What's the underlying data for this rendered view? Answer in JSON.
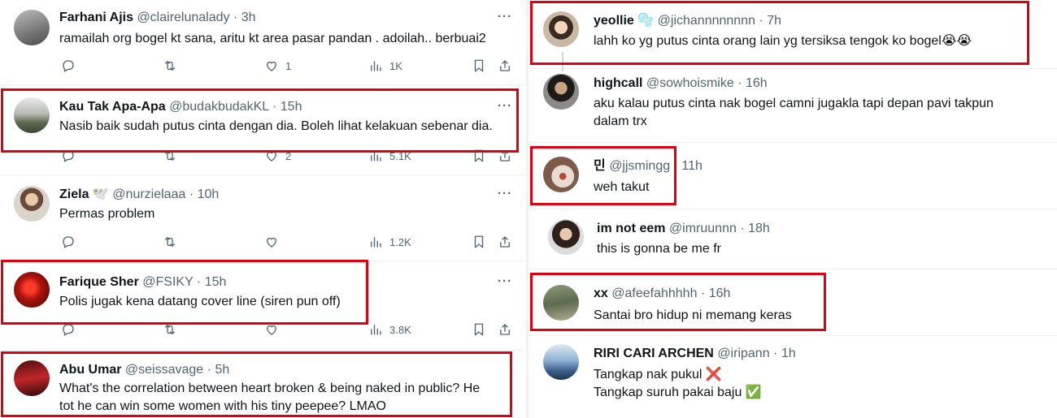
{
  "left": [
    {
      "name": "Farhani Ajis",
      "handle": "@clairelunalady",
      "time": "3h",
      "text": [
        "ramailah org bogel kt sana, aritu kt area pasar pandan . adoilah.. berbuai2"
      ],
      "likes": "1",
      "views": "1K"
    },
    {
      "name": "Kau Tak Apa-Apa",
      "handle": "@budakbudakKL",
      "time": "15h",
      "text": [
        "Nasib baik sudah putus cinta dengan dia. Boleh lihat kelakuan sebenar dia."
      ],
      "likes": "2",
      "views": "5.1K"
    },
    {
      "name": "Ziela",
      "name_emoji": "🕊️",
      "handle": "@nurzielaaa",
      "time": "10h",
      "text": [
        "Permas problem"
      ],
      "likes": "",
      "views": "1.2K"
    },
    {
      "name": "Farique Sher",
      "handle": "@FSIKY",
      "time": "15h",
      "text": [
        "Polis jugak kena datang cover line (siren pun off)"
      ],
      "likes": "",
      "views": "3.8K"
    },
    {
      "name": "Abu Umar",
      "handle": "@seissavage",
      "time": "5h",
      "text": [
        "What's the correlation between heart broken & being naked in public? He",
        "tot he can win some women with his tiny peepee? LMAO"
      ]
    }
  ],
  "right": [
    {
      "name": "yeollie",
      "name_emoji": "🫧",
      "handle": "@jichannnnnnnn",
      "time": "7h",
      "text": [
        "lahh ko yg putus cinta orang lain yg tersiksa tengok ko bogel😭😭"
      ]
    },
    {
      "name": "highcall",
      "handle": "@sowhoismike",
      "time": "16h",
      "text": [
        "aku kalau putus cinta nak bogel camni jugakla tapi depan pavi takpun",
        "dalam trx"
      ]
    },
    {
      "name": "민",
      "handle": "@jjsmingg",
      "time": "11h",
      "text": [
        "weh takut"
      ]
    },
    {
      "name": "im not eem",
      "handle": "@imruunnn",
      "time": "18h",
      "text": [
        "this is gonna be me fr"
      ]
    },
    {
      "name": "xx",
      "handle": "@afeefahhhhh",
      "time": "16h",
      "text": [
        "Santai bro hidup ni memang keras"
      ]
    },
    {
      "name": "RIRI CARI ARCHEN",
      "handle": "@iripann",
      "time": "1h",
      "text": [
        "Tangkap nak pukul ❌",
        "Tangkap suruh pakai baju ✅"
      ]
    }
  ],
  "dot": "·",
  "more_glyph": "···",
  "colors": {
    "highlight": "#e0000f",
    "secondary_text": "#536471",
    "separator": "#eff3f4"
  }
}
